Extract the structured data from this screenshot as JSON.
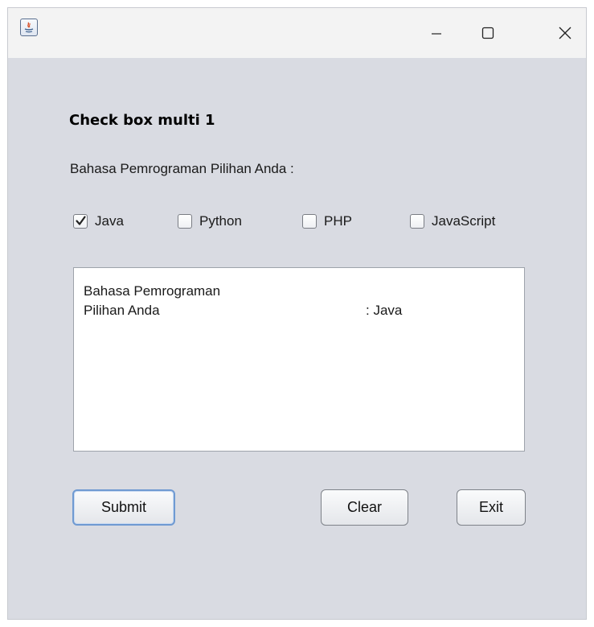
{
  "window": {
    "title_label": "Check box multi 1",
    "prompt_label": "Bahasa Pemrograman Pilihan Anda :"
  },
  "checkboxes": [
    {
      "label": "Java",
      "checked": true
    },
    {
      "label": "Python",
      "checked": false
    },
    {
      "label": "PHP",
      "checked": false
    },
    {
      "label": "JavaScript",
      "checked": false
    }
  ],
  "output": {
    "line1": "Bahasa Pemrograman",
    "line2_label": "Pilihan Anda",
    "line2_value": ": Java"
  },
  "buttons": {
    "submit": "Submit",
    "clear": "Clear",
    "exit": "Exit"
  },
  "colors": {
    "window_bg": "#d9dbe2",
    "titlebar_bg": "#f3f3f3",
    "focus_border": "#6f9ad2"
  },
  "icons": {
    "app": "java-app-icon",
    "minimize": "minimize-icon",
    "maximize": "maximize-icon",
    "close": "close-icon",
    "check": "checkmark-icon"
  }
}
